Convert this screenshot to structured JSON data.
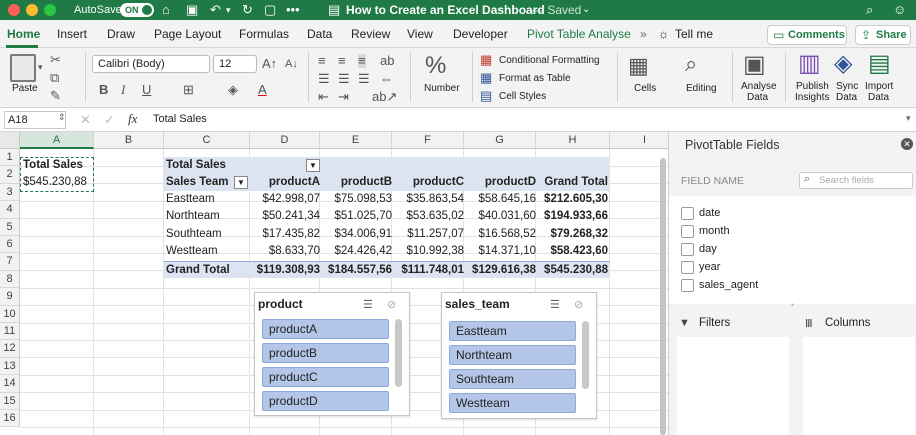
{
  "titlebar": {
    "autosave_label": "AutoSave",
    "autosave_state": "ON",
    "doc_title": "How to Create an Excel Dashboard",
    "doc_status": "— Saved",
    "chevron": "⌄"
  },
  "tabs": [
    "Home",
    "Insert",
    "Draw",
    "Page Layout",
    "Formulas",
    "Data",
    "Review",
    "View",
    "Developer",
    "Pivot Table Analyse"
  ],
  "tell_me": "Tell me",
  "header_buttons": {
    "comments": "Comments",
    "share": "Share"
  },
  "ribbon": {
    "paste": "Paste",
    "font_name": "Calibri (Body)",
    "font_size": "12",
    "number": "Number",
    "conditional_formatting": "Conditional Formatting",
    "format_as_table": "Format as Table",
    "cell_styles": "Cell Styles",
    "cells": "Cells",
    "editing": "Editing",
    "analyse_data": [
      "Analyse",
      "Data"
    ],
    "publish_insights": [
      "Publish",
      "Insights"
    ],
    "sync_data": [
      "Sync",
      "Data"
    ],
    "import_data": [
      "Import",
      "Data"
    ]
  },
  "formula_bar": {
    "name_box": "A18",
    "fx": "fx",
    "value": "Total Sales"
  },
  "columns": [
    "A",
    "B",
    "C",
    "D",
    "E",
    "F",
    "G",
    "H",
    "I"
  ],
  "rows": [
    "1",
    "2",
    "3",
    "4",
    "5",
    "6",
    "7",
    "8",
    "9",
    "10",
    "11",
    "12",
    "13",
    "14",
    "15",
    "16"
  ],
  "cells": {
    "a1": "Total Sales",
    "a2": "$545.230,88"
  },
  "pivot": {
    "title": "Total Sales",
    "row_header": "Sales Team",
    "headers": [
      "productA",
      "productB",
      "productC",
      "productD",
      "Grand Total"
    ],
    "rows": [
      {
        "team": "Eastteam",
        "values": [
          "$42.998,07",
          "$75.098,53",
          "$35.863,54",
          "$58.645,16",
          "$212.605,30"
        ]
      },
      {
        "team": "Northteam",
        "values": [
          "$50.241,34",
          "$51.025,70",
          "$53.635,02",
          "$40.031,60",
          "$194.933,66"
        ]
      },
      {
        "team": "Southteam",
        "values": [
          "$17.435,82",
          "$34.006,91",
          "$11.257,07",
          "$16.568,52",
          "$79.268,32"
        ]
      },
      {
        "team": "Westteam",
        "values": [
          "$8.633,70",
          "$24.426,42",
          "$10.992,38",
          "$14.371,10",
          "$58.423,60"
        ]
      }
    ],
    "grand_total_label": "Grand Total",
    "grand_total": [
      "$119.308,93",
      "$184.557,56",
      "$111.748,01",
      "$129.616,38",
      "$545.230,88"
    ]
  },
  "slicer_product": {
    "title": "product",
    "items": [
      "productA",
      "productB",
      "productC",
      "productD"
    ]
  },
  "slicer_team": {
    "title": "sales_team",
    "items": [
      "Eastteam",
      "Northteam",
      "Southteam",
      "Westteam"
    ]
  },
  "pivot_pane": {
    "title": "PivotTable Fields",
    "field_name": "FIELD NAME",
    "search_placeholder": "Search fields",
    "fields": [
      "date",
      "month",
      "day",
      "year",
      "sales_agent"
    ],
    "filters": "Filters",
    "columns": "Columns"
  },
  "colors": {
    "accent": "#1f7a45",
    "pivot_header": "#dce4f2",
    "slicer_item": "#b4c6e7"
  }
}
